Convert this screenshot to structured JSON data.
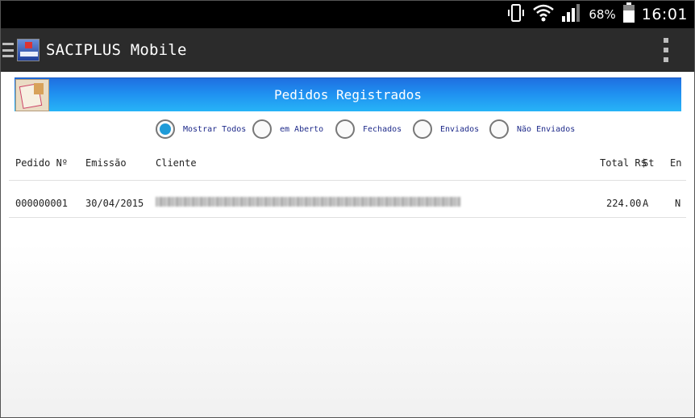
{
  "status_bar": {
    "battery_pct": "68%",
    "time": "16:01",
    "icons": [
      "vibrate-icon",
      "wifi-icon",
      "signal-icon",
      "battery-icon"
    ]
  },
  "action_bar": {
    "title": "SACIPLUS Mobile",
    "icons": [
      "menu-icon",
      "app-logo-icon",
      "overflow-menu-icon"
    ]
  },
  "banner": {
    "title": "Pedidos Registrados",
    "icon": "orders-icon"
  },
  "filters": {
    "options": [
      {
        "label": "Mostrar Todos",
        "checked": true
      },
      {
        "label": "em Aberto",
        "checked": false
      },
      {
        "label": "Fechados",
        "checked": false
      },
      {
        "label": "Enviados",
        "checked": false
      },
      {
        "label": "Não Enviados",
        "checked": false
      }
    ]
  },
  "table": {
    "headers": {
      "pedido": "Pedido Nº",
      "emissao": "Emissão",
      "cliente": "Cliente",
      "total": "Total R$",
      "st": "St",
      "en": "En"
    },
    "rows": [
      {
        "pedido": "000000001",
        "emissao": "30/04/2015",
        "cliente": "",
        "total": "224.00",
        "st": "A",
        "en": "N"
      }
    ]
  },
  "colors": {
    "banner_start": "#1f6fe0",
    "banner_end": "#27b4f7",
    "radio_checked": "#1e9bd8",
    "radio_label": "#1e2a8a",
    "action_bar": "#2b2b2b"
  }
}
